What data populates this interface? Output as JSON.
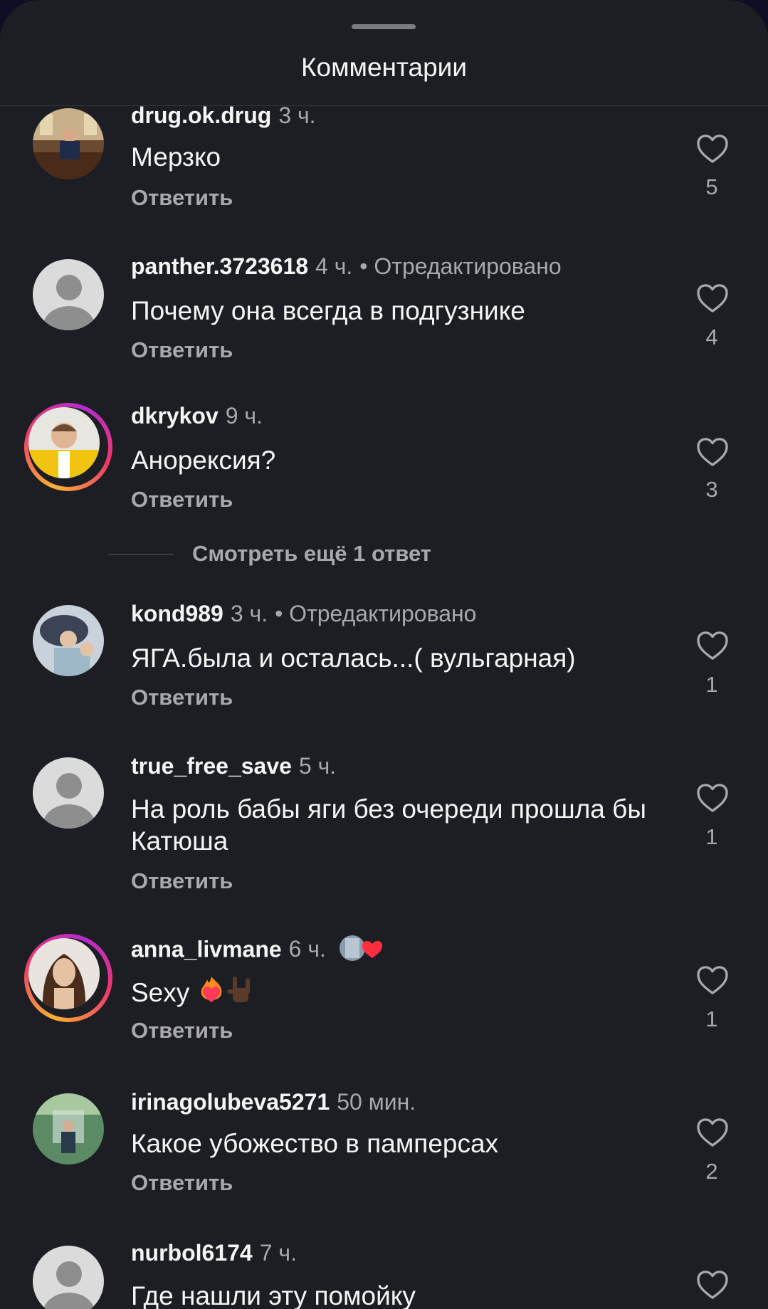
{
  "sheet": {
    "title": "Комментарии"
  },
  "reply_label": "Ответить",
  "more_replies_label": "Смотреть ещё 1 ответ",
  "comments": [
    {
      "username": "drug.ok.drug",
      "time": "3 ч.",
      "edited": "",
      "text": "Мерзко",
      "likes": "5",
      "avatar": "photo-office"
    },
    {
      "username": "panther.3723618",
      "time": "4 ч.",
      "edited": "• Отредактировано",
      "text": "Почему она всегда в подгузнике",
      "likes": "4",
      "avatar": "default"
    },
    {
      "username": "dkrykov",
      "time": "9 ч.",
      "edited": "",
      "text": "Анорексия?",
      "likes": "3",
      "avatar": "photo-story-ring"
    },
    {
      "username": "kond989",
      "time": "3 ч.",
      "edited": "• Отредактировано",
      "text": "ЯГА.была и осталась...( вульгарная)",
      "likes": "1",
      "avatar": "photo-hat"
    },
    {
      "username": "true_free_save",
      "time": "5 ч.",
      "edited": "",
      "text": "На роль бабы яги без очереди прошла бы Катюша",
      "likes": "1",
      "avatar": "default"
    },
    {
      "username": "anna_livmane",
      "time": "6 ч.",
      "edited": "",
      "text": "Sexy",
      "text_emojis": [
        "heart-on-fire-emoji",
        "rock-hand-emoji"
      ],
      "badge": "author-liked-heart",
      "likes": "1",
      "avatar": "photo-story-ring"
    },
    {
      "username": "irinagolubeva5271",
      "time": "50 мин.",
      "edited": "",
      "text": "Какое убожество в памперсах",
      "likes": "2",
      "avatar": "photo-garden"
    },
    {
      "username": "nurbol6174",
      "time": "7 ч.",
      "edited": "",
      "text": "Где нашли эту помойку",
      "likes": "",
      "avatar": "default"
    }
  ],
  "colors": {
    "background": "#1c1e24",
    "primary_text": "#f5f5f5",
    "secondary_text": "#a8a8ad",
    "heart_red": "#ff2d3d"
  }
}
